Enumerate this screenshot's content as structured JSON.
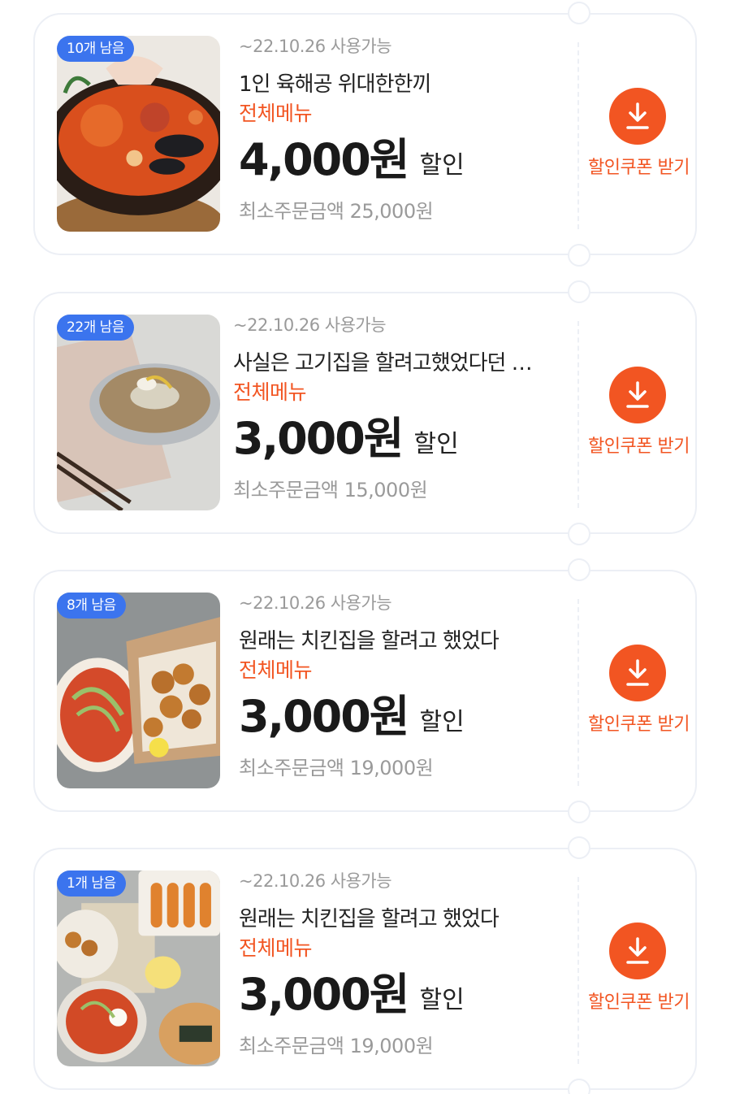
{
  "coupons": [
    {
      "stock_badge": "10개 남음",
      "validity": "~22.10.26 사용가능",
      "name": "1인 육해공 위대한한끼",
      "scope": "전체메뉴",
      "amount": "4,000원",
      "amount_suffix": "할인",
      "min_order": "최소주문금액 25,000원",
      "button_label": "할인쿠폰 받기"
    },
    {
      "stock_badge": "22개 남음",
      "validity": "~22.10.26 사용가능",
      "name": "사실은 고기집을 할려고했었다던 …",
      "scope": "전체메뉴",
      "amount": "3,000원",
      "amount_suffix": "할인",
      "min_order": "최소주문금액 15,000원",
      "button_label": "할인쿠폰 받기"
    },
    {
      "stock_badge": "8개 남음",
      "validity": "~22.10.26 사용가능",
      "name": "원래는 치킨집을 할려고 했었다",
      "scope": "전체메뉴",
      "amount": "3,000원",
      "amount_suffix": "할인",
      "min_order": "최소주문금액 19,000원",
      "button_label": "할인쿠폰 받기"
    },
    {
      "stock_badge": "1개 남음",
      "validity": "~22.10.26 사용가능",
      "name": "원래는 치킨집을 할려고 했었다",
      "scope": "전체메뉴",
      "amount": "3,000원",
      "amount_suffix": "할인",
      "min_order": "최소주문금액 19,000원",
      "button_label": "할인쿠폰 받기"
    }
  ],
  "colors": {
    "accent": "#f25522",
    "badge": "#3b74ee",
    "card_border": "#eceff5"
  },
  "icons": {
    "download": "download-icon"
  }
}
